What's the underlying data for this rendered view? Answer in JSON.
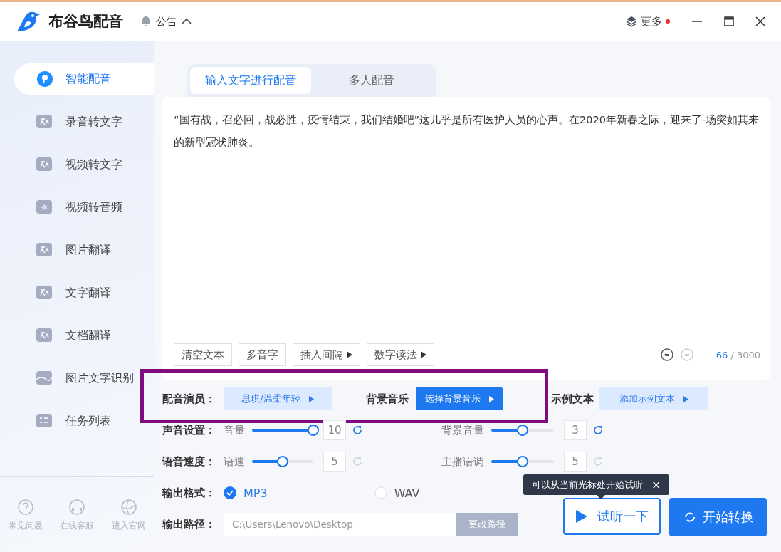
{
  "app": {
    "name": "布谷鸟配音",
    "notice": "公告",
    "more": "更多",
    "more_badge": true
  },
  "sidebar": {
    "items": [
      {
        "label": "智能配音",
        "selected": true
      },
      {
        "label": "录音转文字",
        "selected": false
      },
      {
        "label": "视频转文字",
        "selected": false
      },
      {
        "label": "视频转音频",
        "selected": false
      },
      {
        "label": "图片翻译",
        "selected": false
      },
      {
        "label": "文字翻译",
        "selected": false
      },
      {
        "label": "文档翻译",
        "selected": false
      },
      {
        "label": "图片文字识别",
        "selected": false
      },
      {
        "label": "任务列表",
        "selected": false
      }
    ],
    "footer": [
      {
        "label": "常见问题"
      },
      {
        "label": "在线客服"
      },
      {
        "label": "进入官网"
      }
    ]
  },
  "tabs": [
    {
      "label": "输入文字进行配音",
      "selected": true
    },
    {
      "label": "多人配音",
      "selected": false
    }
  ],
  "editor": {
    "text": "“国有战，召必回，战必胜，疫情结束，我们结婚吧”这几乎是所有医护人员的心声。在2020年新春之际，迎来了-场突如其来的新型冠状肺炎。",
    "tools": [
      {
        "label": "清空文本",
        "menu": false
      },
      {
        "label": "多音字",
        "menu": false
      },
      {
        "label": "插入间隔",
        "menu": true
      },
      {
        "label": "数字读法",
        "menu": true
      }
    ],
    "count": "66",
    "limit": "/ 3000"
  },
  "voice": {
    "label": "配音演员：",
    "value": "思琪/温柔年轻"
  },
  "bgm": {
    "label": "背景音乐",
    "value": "选择背景音乐"
  },
  "sample": {
    "label": "示例文本",
    "value": "添加示例文本"
  },
  "sliders": [
    {
      "label": "声音设置：",
      "items": [
        {
          "name": "音量",
          "level": 1.0,
          "reading": "10",
          "resettable": true
        },
        {
          "name": "背景音量",
          "level": 0.5,
          "reading": "3",
          "resettable": true
        }
      ]
    },
    {
      "label": "语音速度：",
      "items": [
        {
          "name": "语速",
          "level": 0.5,
          "reading": "5",
          "resettable": false
        },
        {
          "name": "主播语调",
          "level": 0.5,
          "reading": "5",
          "resettable": false
        }
      ]
    }
  ],
  "format": {
    "label": "输出格式：",
    "options": [
      {
        "label": "MP3",
        "selected": true
      },
      {
        "label": "WAV",
        "selected": false
      }
    ]
  },
  "path": {
    "label": "输出路径：",
    "value": "C:\\Users\\Lenovo\\Desktop",
    "button": "更改路径"
  },
  "tooltip": {
    "text": "可以从当前光标处开始试听",
    "close": "×"
  },
  "actions": {
    "preview": "试听一下",
    "start": "开始转换"
  }
}
